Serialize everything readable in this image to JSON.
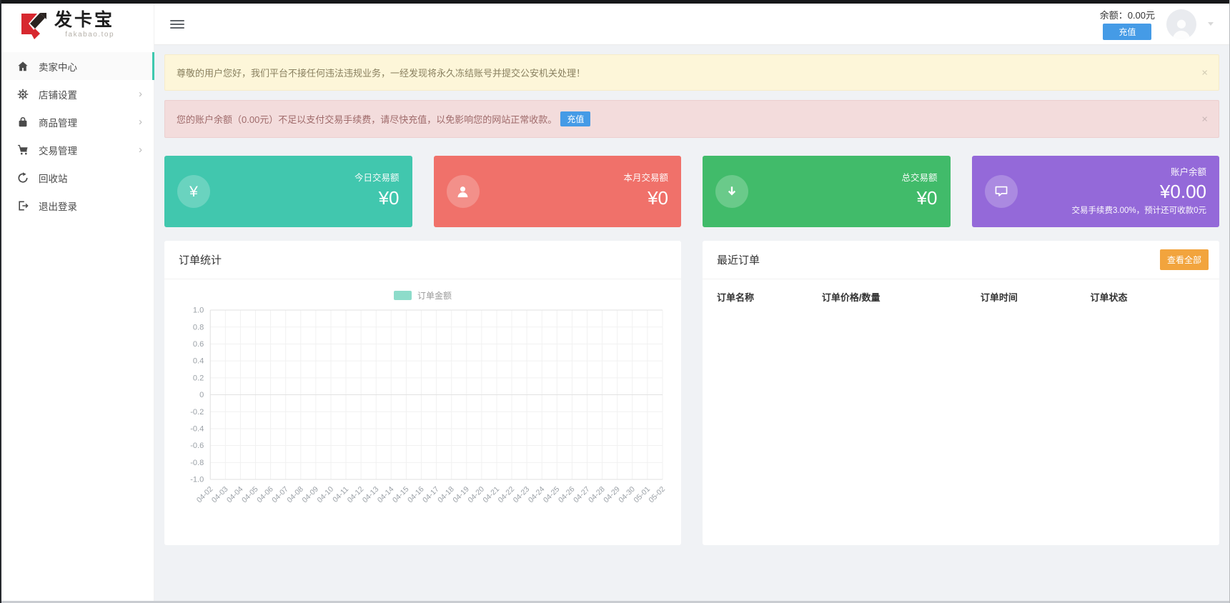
{
  "brand": {
    "name": "发卡宝",
    "domain": "fakabao.top"
  },
  "header": {
    "balance_label": "余额：0.00元",
    "recharge_button": "充值"
  },
  "sidebar": {
    "items": [
      {
        "id": "seller-center",
        "label": "卖家中心",
        "icon": "home-icon",
        "active": true,
        "has_submenu": false
      },
      {
        "id": "shop-settings",
        "label": "店铺设置",
        "icon": "gear-icon",
        "active": false,
        "has_submenu": true
      },
      {
        "id": "goods-manage",
        "label": "商品管理",
        "icon": "bag-icon",
        "active": false,
        "has_submenu": true
      },
      {
        "id": "trade-manage",
        "label": "交易管理",
        "icon": "cart-icon",
        "active": false,
        "has_submenu": true
      },
      {
        "id": "recycle-bin",
        "label": "回收站",
        "icon": "recycle-icon",
        "active": false,
        "has_submenu": false
      },
      {
        "id": "logout",
        "label": "退出登录",
        "icon": "logout-icon",
        "active": false,
        "has_submenu": false
      }
    ]
  },
  "alerts": [
    {
      "type": "warning",
      "text": "尊敬的用户您好，我们平台不接任何违法违规业务，一经发现将永久冻结账号并提交公安机关处理！",
      "close": "×"
    },
    {
      "type": "danger",
      "text": "您的账户余额（0.00元）不足以支付交易手续费，请尽快充值，以免影响您的网站正常收款。",
      "button": "充值",
      "close": "×"
    }
  ],
  "stat_cards": [
    {
      "label": "今日交易额",
      "value": "¥0",
      "icon": "yen-icon",
      "color": "#41c7ae"
    },
    {
      "label": "本月交易额",
      "value": "¥0",
      "icon": "user-icon",
      "color": "#f0716a"
    },
    {
      "label": "总交易额",
      "value": "¥0",
      "icon": "arrow-down-icon",
      "color": "#41bb6a"
    },
    {
      "label": "账户余额",
      "value": "¥0.00",
      "icon": "chat-icon",
      "color": "#9469d9",
      "note": "交易手续费3.00%，预计还可收款0元"
    }
  ],
  "order_stats": {
    "title": "订单统计",
    "chart_data": {
      "type": "line",
      "title": "订单统计",
      "legend": [
        "订单金额"
      ],
      "legend_position": "top",
      "series": [
        {
          "name": "订单金额",
          "color": "#8ddcca",
          "values": []
        }
      ],
      "x": [
        "04-02",
        "04-03",
        "04-04",
        "04-05",
        "04-06",
        "04-07",
        "04-08",
        "04-09",
        "04-10",
        "04-11",
        "04-12",
        "04-13",
        "04-14",
        "04-15",
        "04-16",
        "04-17",
        "04-18",
        "04-19",
        "04-20",
        "04-21",
        "04-22",
        "04-23",
        "04-24",
        "04-25",
        "04-26",
        "04-27",
        "04-28",
        "04-29",
        "04-30",
        "05-01",
        "05-02"
      ],
      "ylim": [
        -1,
        1
      ],
      "yticks": [
        "1.0",
        "0.8",
        "0.6",
        "0.4",
        "0.2",
        "0",
        "-0.2",
        "-0.4",
        "-0.6",
        "-0.8",
        "-1.0"
      ],
      "grid": true
    }
  },
  "recent_orders": {
    "title": "最近订单",
    "view_all_button": "查看全部",
    "columns": [
      "订单名称",
      "订单价格/数量",
      "订单时间",
      "订单状态"
    ],
    "rows": []
  },
  "colors": {
    "accent_teal": "#3ec8ae",
    "recharge_blue": "#459be6",
    "view_all_orange": "#f2a43d",
    "alert_warning_bg": "#fdf6d9",
    "alert_danger_bg": "#f3dcdc",
    "body_bg": "#f0f2f5"
  }
}
